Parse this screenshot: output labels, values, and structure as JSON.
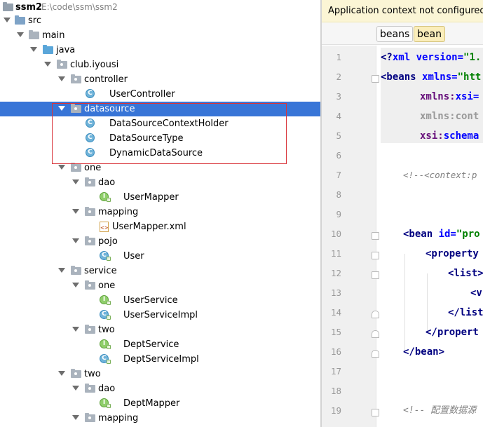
{
  "project": {
    "name": "ssm2",
    "path": "E:\\code\\ssm\\ssm2"
  },
  "tree": {
    "src": "src",
    "main": "main",
    "java": "java",
    "club_iyousi": "club.iyousi",
    "controller": "controller",
    "user_controller": "UserController",
    "datasource": "datasource",
    "data_source_context_holder": "DataSourceContextHolder",
    "data_source_type": "DataSourceType",
    "dynamic_data_source": "DynamicDataSource",
    "one": "one",
    "one_dao": "dao",
    "user_mapper": "UserMapper",
    "one_mapping": "mapping",
    "user_mapper_xml": "UserMapper.xml",
    "pojo": "pojo",
    "user": "User",
    "service": "service",
    "service_one": "one",
    "user_service": "UserService",
    "user_service_impl": "UserServiceImpl",
    "service_two": "two",
    "dept_service": "DeptService",
    "dept_service_impl": "DeptServiceImpl",
    "two": "two",
    "two_dao": "dao",
    "dept_mapper": "DeptMapper",
    "two_mapping": "mapping"
  },
  "editor": {
    "notice": "Application context not configured for",
    "breadcrumbs": [
      "beans",
      "bean"
    ],
    "line_numbers": [
      "1",
      "2",
      "3",
      "4",
      "5",
      "6",
      "7",
      "8",
      "9",
      "10",
      "11",
      "12",
      "13",
      "14",
      "15",
      "16",
      "17",
      "18",
      "19"
    ],
    "code": {
      "l1_a": "<?",
      "l1_b": "xml version=",
      "l1_c": "\"1.",
      "l2_a": "<beans ",
      "l2_b": "xmlns=",
      "l2_c": "\"htt",
      "l3_a": "xmlns:",
      "l3_b": "xsi=",
      "l4_a": "xmlns:cont",
      "l5_a": "xsi:",
      "l5_b": "schema",
      "l7": "<!--<context:p",
      "l10_a": "<bean ",
      "l10_b": "id=",
      "l10_c": "\"pro",
      "l11": "<property",
      "l12": "<list>",
      "l13": "<v",
      "l14": "</list",
      "l15": "</propert",
      "l16": "</bean>",
      "l19": "<!-- 配置数据源"
    }
  }
}
